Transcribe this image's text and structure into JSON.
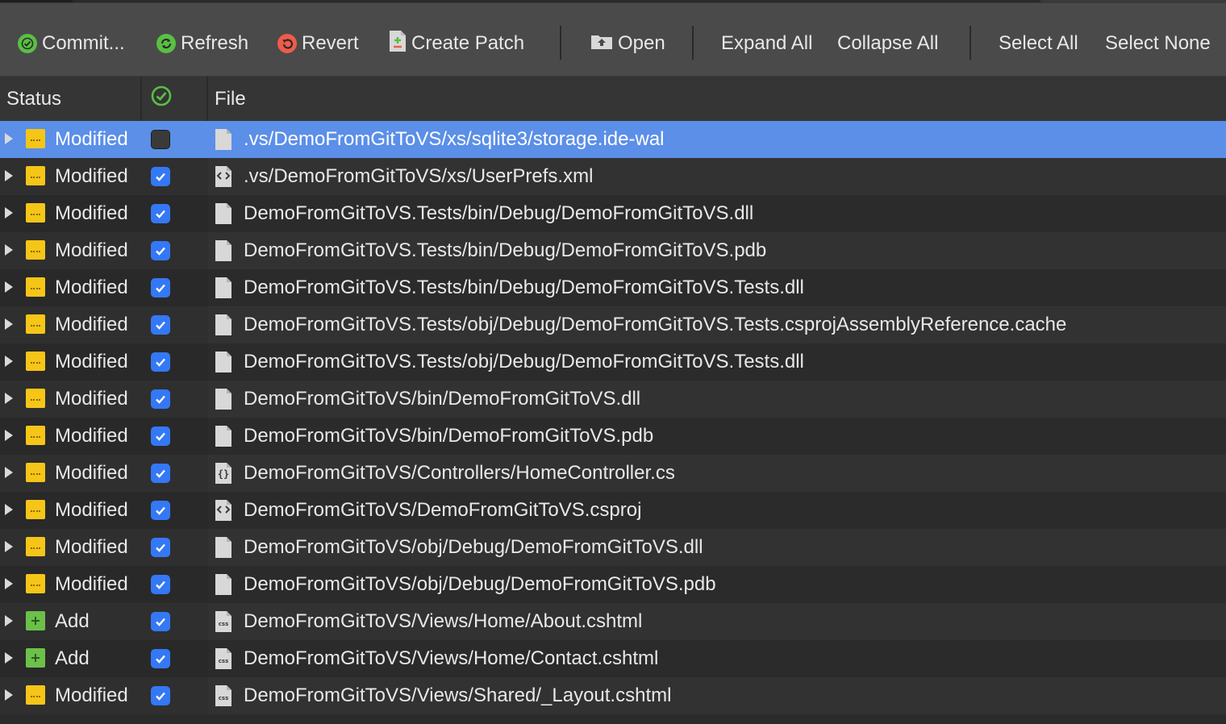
{
  "toolbar": {
    "commit": "Commit...",
    "refresh": "Refresh",
    "revert": "Revert",
    "create_patch": "Create Patch",
    "open": "Open",
    "expand_all": "Expand All",
    "collapse_all": "Collapse All",
    "select_all": "Select All",
    "select_none": "Select None"
  },
  "columns": {
    "status": "Status",
    "file": "File"
  },
  "colors": {
    "accent": "#5b8fe8",
    "modified": "#f5c518",
    "added": "#6cc04a",
    "checkbox": "#3478f6",
    "commit_icon": "#59c043",
    "revert_icon": "#ef5b4b"
  },
  "files": [
    {
      "status": "Modified",
      "kind": "modified",
      "checked": false,
      "selected": true,
      "icon": "blank-file-icon",
      "path": ".vs/DemoFromGitToVS/xs/sqlite3/storage.ide-wal"
    },
    {
      "status": "Modified",
      "kind": "modified",
      "checked": true,
      "selected": false,
      "icon": "xml-file-icon",
      "path": ".vs/DemoFromGitToVS/xs/UserPrefs.xml"
    },
    {
      "status": "Modified",
      "kind": "modified",
      "checked": true,
      "selected": false,
      "icon": "blank-file-icon",
      "path": "DemoFromGitToVS.Tests/bin/Debug/DemoFromGitToVS.dll"
    },
    {
      "status": "Modified",
      "kind": "modified",
      "checked": true,
      "selected": false,
      "icon": "blank-file-icon",
      "path": "DemoFromGitToVS.Tests/bin/Debug/DemoFromGitToVS.pdb"
    },
    {
      "status": "Modified",
      "kind": "modified",
      "checked": true,
      "selected": false,
      "icon": "blank-file-icon",
      "path": "DemoFromGitToVS.Tests/bin/Debug/DemoFromGitToVS.Tests.dll"
    },
    {
      "status": "Modified",
      "kind": "modified",
      "checked": true,
      "selected": false,
      "icon": "blank-file-icon",
      "path": "DemoFromGitToVS.Tests/obj/Debug/DemoFromGitToVS.Tests.csprojAssemblyReference.cache"
    },
    {
      "status": "Modified",
      "kind": "modified",
      "checked": true,
      "selected": false,
      "icon": "blank-file-icon",
      "path": "DemoFromGitToVS.Tests/obj/Debug/DemoFromGitToVS.Tests.dll"
    },
    {
      "status": "Modified",
      "kind": "modified",
      "checked": true,
      "selected": false,
      "icon": "blank-file-icon",
      "path": "DemoFromGitToVS/bin/DemoFromGitToVS.dll"
    },
    {
      "status": "Modified",
      "kind": "modified",
      "checked": true,
      "selected": false,
      "icon": "blank-file-icon",
      "path": "DemoFromGitToVS/bin/DemoFromGitToVS.pdb"
    },
    {
      "status": "Modified",
      "kind": "modified",
      "checked": true,
      "selected": false,
      "icon": "code-file-icon",
      "path": "DemoFromGitToVS/Controllers/HomeController.cs"
    },
    {
      "status": "Modified",
      "kind": "modified",
      "checked": true,
      "selected": false,
      "icon": "xml-file-icon",
      "path": "DemoFromGitToVS/DemoFromGitToVS.csproj"
    },
    {
      "status": "Modified",
      "kind": "modified",
      "checked": true,
      "selected": false,
      "icon": "blank-file-icon",
      "path": "DemoFromGitToVS/obj/Debug/DemoFromGitToVS.dll"
    },
    {
      "status": "Modified",
      "kind": "modified",
      "checked": true,
      "selected": false,
      "icon": "blank-file-icon",
      "path": "DemoFromGitToVS/obj/Debug/DemoFromGitToVS.pdb"
    },
    {
      "status": "Add",
      "kind": "add",
      "checked": true,
      "selected": false,
      "icon": "css-file-icon",
      "path": "DemoFromGitToVS/Views/Home/About.cshtml"
    },
    {
      "status": "Add",
      "kind": "add",
      "checked": true,
      "selected": false,
      "icon": "css-file-icon",
      "path": "DemoFromGitToVS/Views/Home/Contact.cshtml"
    },
    {
      "status": "Modified",
      "kind": "modified",
      "checked": true,
      "selected": false,
      "icon": "css-file-icon",
      "path": "DemoFromGitToVS/Views/Shared/_Layout.cshtml"
    }
  ]
}
